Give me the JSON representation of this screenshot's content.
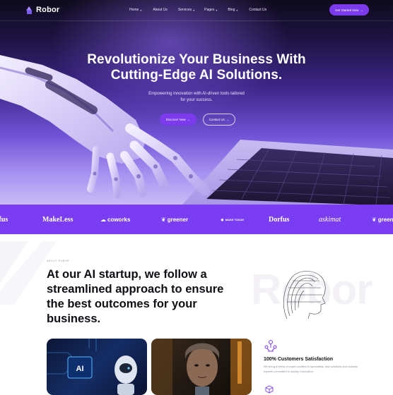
{
  "brand": {
    "name": "Robor"
  },
  "nav": {
    "items": [
      {
        "label": "Home",
        "dropdown": true
      },
      {
        "label": "About Us",
        "dropdown": false
      },
      {
        "label": "Services",
        "dropdown": true
      },
      {
        "label": "Pages",
        "dropdown": true
      },
      {
        "label": "Blog",
        "dropdown": true
      },
      {
        "label": "Contact Us",
        "dropdown": false
      }
    ],
    "cta_label": "Get Started Now"
  },
  "hero": {
    "title_line1": "Revolutionize Your Business With",
    "title_line2": "Cutting-Edge AI Solutions.",
    "subtitle_line1": "Empowering innovation with AI-driven tools tailored",
    "subtitle_line2": "for your success.",
    "primary_button": "Discover Now",
    "secondary_button": "Contact Us"
  },
  "logo_strip": {
    "brands": [
      "rfus",
      "MakeLess",
      "coworks",
      "greener",
      "MAKE TODAY",
      "Dorfus",
      "askimat",
      "greener"
    ]
  },
  "about": {
    "tag": "ABOUT ROBOR",
    "title_line1": "At our AI startup, we follow a",
    "title_line2": "streamlined approach to ensure",
    "title_line3": "the best outcomes for your",
    "title_line4": "business.",
    "watermark": "Robor",
    "card1_label": "AI",
    "stat_title": "100% Customers Satisfaction",
    "stat_desc": "We bring a blend of expert-crafted AI specialists, fast solutions and industry experts committed to startup innovation."
  },
  "colors": {
    "accent": "#7c3aed",
    "strip": "#7b3df2",
    "hero_dark": "#0f0b1d"
  },
  "icons": [
    "logo-mark-icon",
    "chevron-down-icon",
    "arrow-right-icon",
    "users-network-icon",
    "cube-icon"
  ]
}
